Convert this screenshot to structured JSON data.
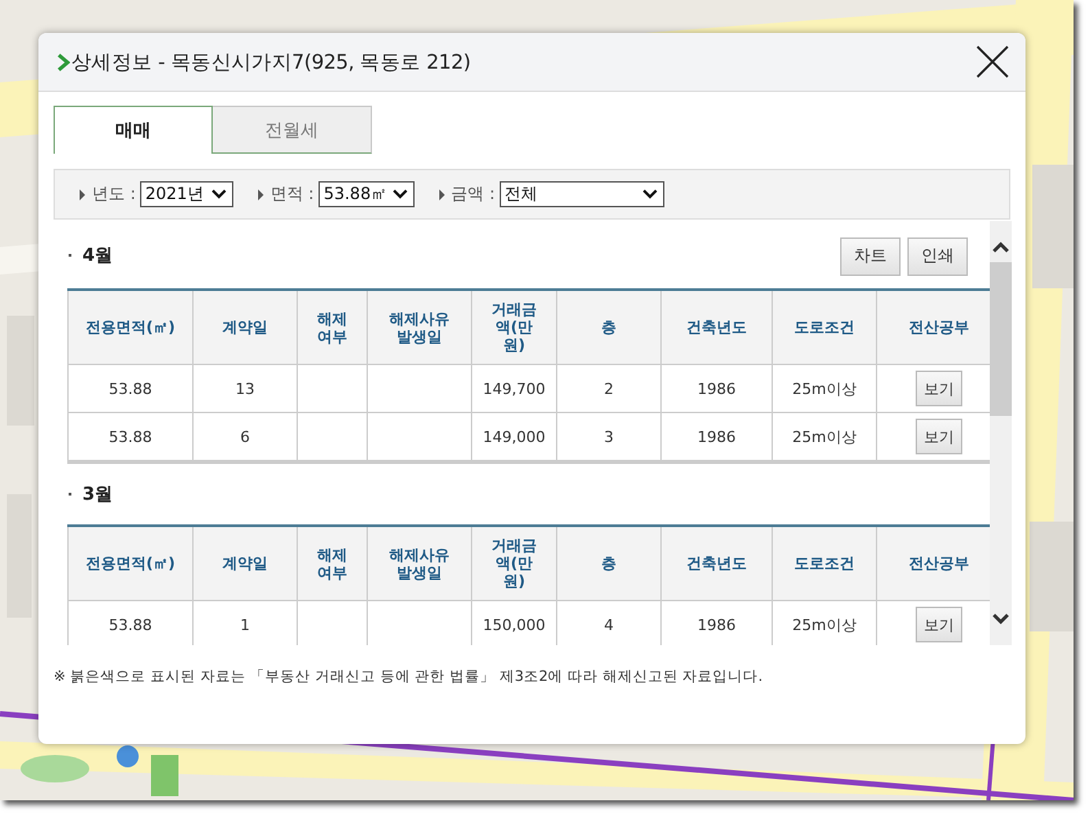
{
  "dialog": {
    "title": "상세정보 - 목동신시가지7(925, 목동로 212)"
  },
  "tabs": [
    {
      "label": "매매",
      "selected": true
    },
    {
      "label": "전월세",
      "selected": false
    }
  ],
  "filters": [
    {
      "label": "년도 :",
      "value": "2021년"
    },
    {
      "label": "면적 :",
      "value": "53.88㎡"
    },
    {
      "label": "금액 :",
      "value": "전체"
    }
  ],
  "buttons": [
    "차트",
    "인쇄"
  ],
  "sections": [
    {
      "heading": "4월",
      "columns": [
        "전용면적(㎡)",
        "계약일",
        "해제 여부",
        "해제사유 발생일",
        "거래금액(만원)",
        "층",
        "건축년도",
        "도로조건",
        "전산공부"
      ],
      "rows": [
        [
          "53.88",
          "13",
          "",
          "",
          "149,700",
          "2",
          "1986",
          "25m이상",
          "보기"
        ],
        [
          "53.88",
          "6",
          "",
          "",
          "149,000",
          "3",
          "1986",
          "25m이상",
          "보기"
        ]
      ]
    },
    {
      "heading": "3월",
      "columns": [
        "전용면적(㎡)",
        "계약일",
        "해제 여부",
        "해제사유 발생일",
        "거래금액(만원)",
        "층",
        "건축년도",
        "도로조건",
        "전산공부"
      ],
      "rows": [
        [
          "53.88",
          "1",
          "",
          "",
          "150,000",
          "4",
          "1986",
          "25m이상",
          "보기"
        ]
      ]
    }
  ],
  "footnote": "※ 붉은색으로 표시된 자료는 「부동산 거래신고 등에 관한 법률」 제3조2에 따라 해제신고된 자료입니다."
}
